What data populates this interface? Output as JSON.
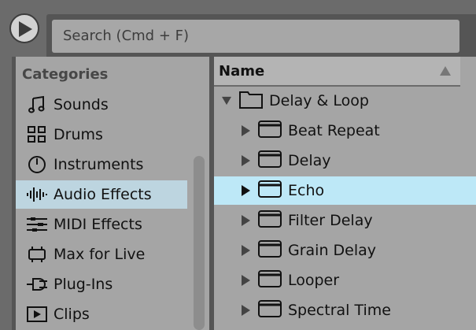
{
  "search": {
    "placeholder": "Search (Cmd + F)"
  },
  "sidebar": {
    "title": "Categories",
    "items": [
      {
        "label": "Sounds",
        "icon": "music-note-icon"
      },
      {
        "label": "Drums",
        "icon": "drum-pad-grid-icon"
      },
      {
        "label": "Instruments",
        "icon": "instrument-knob-icon"
      },
      {
        "label": "Audio Effects",
        "icon": "audio-waveform-icon",
        "selected": true
      },
      {
        "label": "MIDI Effects",
        "icon": "midi-effects-icon"
      },
      {
        "label": "Max for Live",
        "icon": "max-for-live-icon"
      },
      {
        "label": "Plug-Ins",
        "icon": "plug-icon"
      },
      {
        "label": "Clips",
        "icon": "clip-icon"
      }
    ]
  },
  "list": {
    "header": "Name",
    "rows": [
      {
        "label": "Delay & Loop",
        "expanded": true
      },
      {
        "label": "Beat Repeat"
      },
      {
        "label": "Delay"
      },
      {
        "label": "Echo",
        "selected": true
      },
      {
        "label": "Filter Delay"
      },
      {
        "label": "Grain Delay"
      },
      {
        "label": "Looper"
      },
      {
        "label": "Spectral Time"
      }
    ]
  },
  "colors": {
    "selection_sidebar": "#bdd5e0",
    "selection_list": "#bde8f7",
    "panel_bg": "#a5a5a5"
  }
}
